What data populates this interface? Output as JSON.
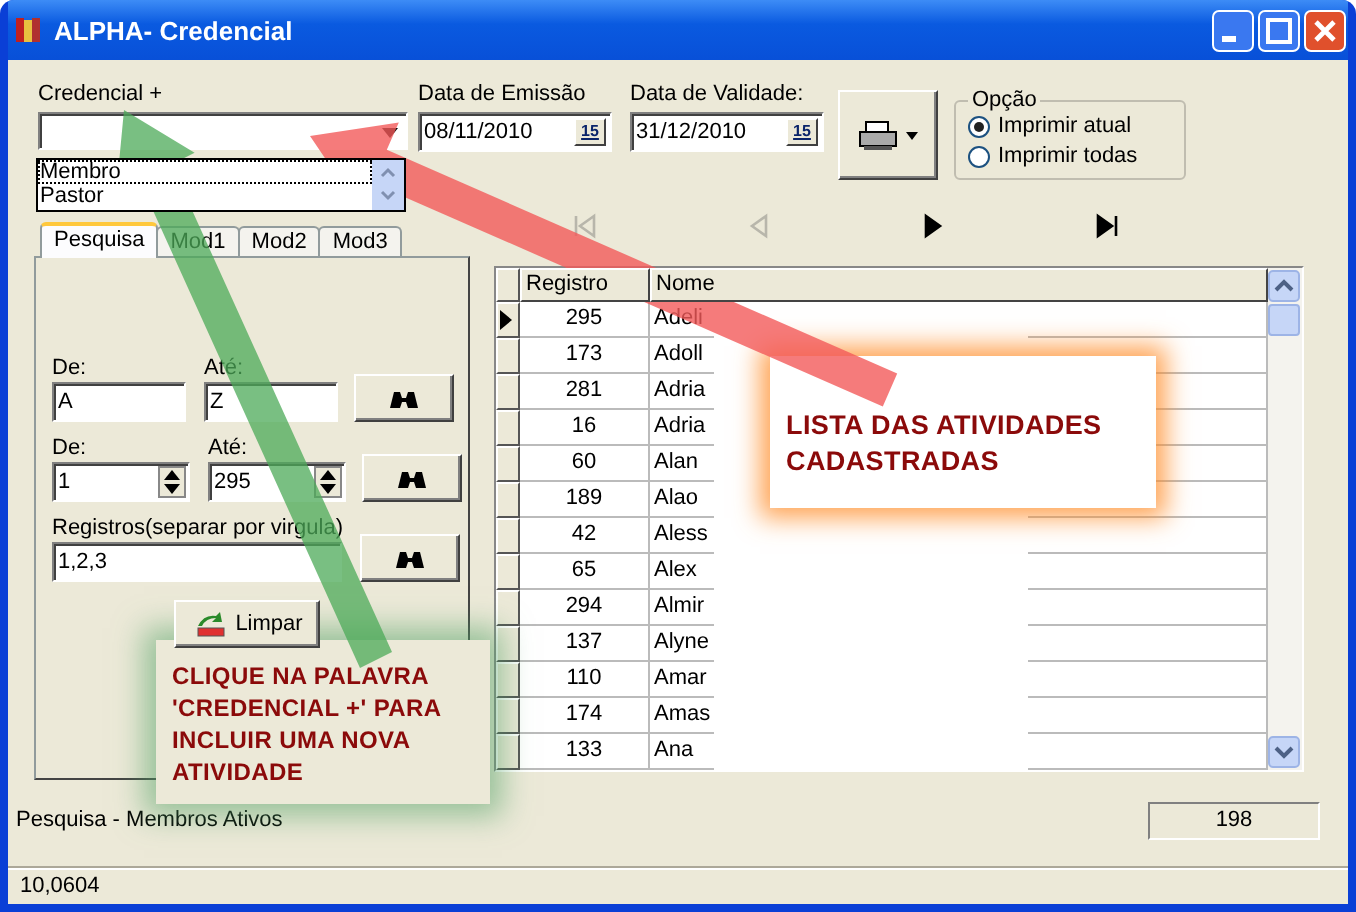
{
  "window": {
    "title": "ALPHA- Credencial"
  },
  "credencial": {
    "label": "Credencial +",
    "options": [
      {
        "label": "Membro",
        "selected": true
      },
      {
        "label": "Pastor",
        "selected": false
      }
    ]
  },
  "dates": [
    {
      "label": "Data de Emissão",
      "value": "08/11/2010",
      "button_text": "15"
    },
    {
      "label": "Data de Validade:",
      "value": "31/12/2010",
      "button_text": "15"
    }
  ],
  "option_group": {
    "title": "Opção",
    "radios": [
      {
        "label": "Imprimir atual",
        "selected": true
      },
      {
        "label": "Imprimir todas",
        "selected": false
      }
    ]
  },
  "navigator": [
    {
      "kind": "first",
      "disabled": true
    },
    {
      "kind": "prev",
      "disabled": true
    },
    {
      "kind": "next",
      "disabled": false
    },
    {
      "kind": "last",
      "disabled": false
    }
  ],
  "tabs": [
    {
      "label": "Pesquisa",
      "selected": true
    },
    {
      "label": "Mod1",
      "selected": false
    },
    {
      "label": "Mod2",
      "selected": false
    },
    {
      "label": "Mod3",
      "selected": false
    }
  ],
  "search": {
    "rows": [
      {
        "kind": "text",
        "from_label": "De:",
        "from_value": "A",
        "to_label": "Até:",
        "to_value": "Z"
      },
      {
        "kind": "spin",
        "from_label": "De:",
        "from_value": "1",
        "to_label": "Até:",
        "to_value": "295"
      }
    ],
    "list_label": "Registros(separar por virgula)",
    "list_value": "1,2,3",
    "clear_button": "Limpar"
  },
  "table": {
    "columns": [
      "Registro",
      "Nome"
    ],
    "rows": [
      {
        "registro": "295",
        "nome": "Adeli",
        "selected": true
      },
      {
        "registro": "173",
        "nome": "Adoll",
        "selected": false
      },
      {
        "registro": "281",
        "nome": "Adria",
        "selected": false
      },
      {
        "registro": "16",
        "nome": "Adria",
        "selected": false
      },
      {
        "registro": "60",
        "nome": "Alan",
        "selected": false
      },
      {
        "registro": "189",
        "nome": "Alao",
        "selected": false
      },
      {
        "registro": "42",
        "nome": "Aless",
        "selected": false
      },
      {
        "registro": "65",
        "nome": "Alex",
        "selected": false
      },
      {
        "registro": "294",
        "nome": "Almir",
        "selected": false
      },
      {
        "registro": "137",
        "nome": "Alyne",
        "selected": false
      },
      {
        "registro": "110",
        "nome": "Amar",
        "selected": false
      },
      {
        "registro": "174",
        "nome": "Amas",
        "selected": false
      },
      {
        "registro": "133",
        "nome": "Ana",
        "selected": false
      }
    ]
  },
  "status_text": "Pesquisa - Membros Ativos",
  "record_count": "198",
  "status_bar": "10,0604",
  "callouts": [
    {
      "kind": "green",
      "text": "CLIQUE NA PALAVRA 'CREDENCIAL +' PARA INCLUIR UMA NOVA ATIVIDADE"
    },
    {
      "kind": "orange",
      "text": "LISTA DAS ATIVIDADES CADASTRADAS"
    }
  ]
}
